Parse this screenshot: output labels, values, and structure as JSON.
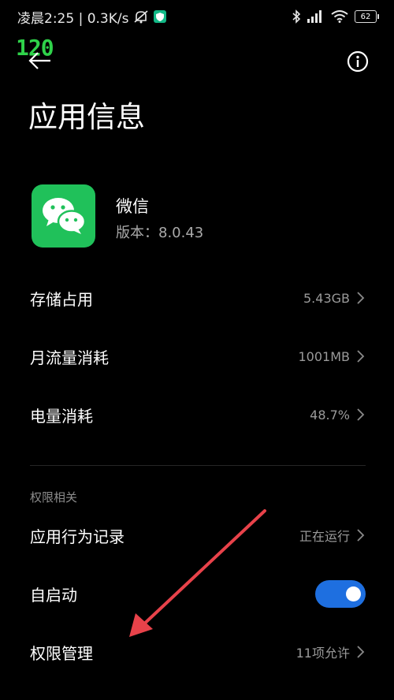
{
  "status_bar": {
    "time_text": "凌晨2:25 | 0.3K/s",
    "battery": "62"
  },
  "badge": "120",
  "header": {
    "title": "应用信息"
  },
  "app": {
    "name": "微信",
    "version": "版本：8.0.43"
  },
  "rows": [
    {
      "label": "存储占用",
      "value": "5.43GB"
    },
    {
      "label": "月流量消耗",
      "value": "1001MB"
    },
    {
      "label": "电量消耗",
      "value": "48.7%"
    }
  ],
  "section": {
    "label": "权限相关"
  },
  "perm_rows": [
    {
      "label": "应用行为记录",
      "value": "正在运行"
    },
    {
      "label": "自启动",
      "toggle_on": true
    },
    {
      "label": "权限管理",
      "value": "11项允许"
    }
  ],
  "colors": {
    "background": "#000000",
    "wechat_green": "#20c15a",
    "toggle_blue": "#1e6fe0",
    "annotation_arrow": "#e8424a"
  },
  "icons": {
    "back": "back-arrow-icon",
    "info": "info-icon",
    "chevron": "chevron-right-icon",
    "app": "wechat-icon"
  }
}
